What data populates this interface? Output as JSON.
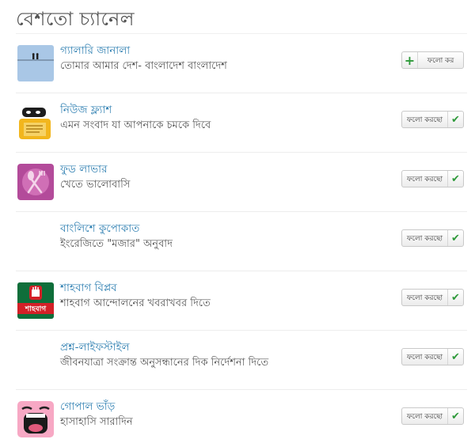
{
  "heading": "বেশতো চ্যানেল",
  "channels": [
    {
      "title": "গ্যালারি জানালা",
      "desc": "তোমার আমার দেশ- বাংলাদেশ বাংলাদেশ",
      "button": "ফলো কর",
      "following": false,
      "avatar": "gallery-birds-avatar"
    },
    {
      "title": "নিউজ ফ্ল্যাশ",
      "desc": "এমন সংবাদ যা আপনাকে চমকে দিবে",
      "button": "ফলো করছো",
      "following": true,
      "avatar": "news-flash-avatar"
    },
    {
      "title": "ফুড লাভার",
      "desc": "খেতে ভালোবাসি",
      "button": "ফলো করছো",
      "following": true,
      "avatar": "food-lover-avatar"
    },
    {
      "title": "বাংলিশে কুপোকাত",
      "desc": "ইংরেজিতে \"মজার\" অনুবাদ",
      "button": "ফলো করছো",
      "following": true,
      "avatar": "none"
    },
    {
      "title": "শাহবাগ বিপ্লব",
      "desc": "শাহবাগ আন্দোলনের খবরাখবর দিতে",
      "button": "ফলো করছো",
      "following": true,
      "avatar": "shahbag-avatar",
      "avatar_text": "শাহবাগ"
    },
    {
      "title": "প্রশ্ন-লাইফস্টাইল",
      "desc": "জীবনযাত্রা সংক্রান্ত অনুসন্ধানের দিক নির্দেশনা দিতে",
      "button": "ফলো করছো",
      "following": true,
      "avatar": "none"
    },
    {
      "title": "গোপাল ভাঁড়",
      "desc": "হাসাহাসি সারাদিন",
      "button": "ফলো করছো",
      "following": true,
      "avatar": "laughing-face-avatar"
    }
  ],
  "colors": {
    "title": "#2b7db0",
    "check": "#2e9a3a"
  }
}
